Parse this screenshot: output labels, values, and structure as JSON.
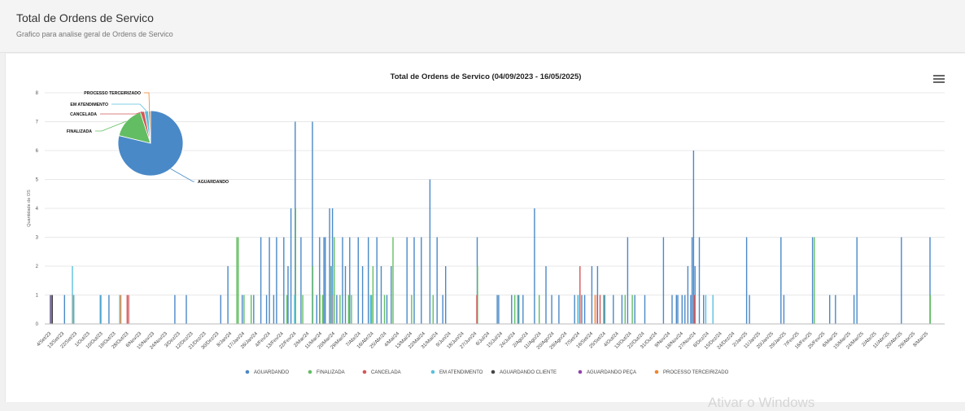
{
  "header": {
    "title": "Total de Ordens de Servico",
    "subtitle": "Grafico para analise geral de Ordens de Servico"
  },
  "watermark": "Ativar o Windows",
  "icons": {
    "menu": "hamburger-menu-icon"
  },
  "chart_data": {
    "type": "bar",
    "title": "Total de Ordens de Servico (04/09/2023 - 16/05/2025)",
    "ylabel": "Quantidade de OS",
    "xlabel": "",
    "ylim": [
      0,
      8
    ],
    "yticks": [
      0,
      1,
      2,
      3,
      4,
      5,
      6,
      7,
      8
    ],
    "grid": true,
    "legend_position": "bottom-center",
    "x_tick_labels": [
      "4/Set/23",
      "13/Set/23",
      "22/Set/23",
      "1/Out/23",
      "10/Out/23",
      "19/Out/23",
      "28/Out/23",
      "6/Nov/23",
      "15/Nov/23",
      "24/Nov/23",
      "3/Dez/23",
      "12/Dez/23",
      "21/Dez/23",
      "30/Dez/23",
      "8/Jan/24",
      "17/Jan/24",
      "26/Jan/24",
      "4/Fev/24",
      "13/Fev/24",
      "22/Fev/24",
      "2/Mar/24",
      "11/Mar/24",
      "20/Mar/24",
      "29/Mar/24",
      "7/Abr/24",
      "16/Abr/24",
      "25/Abr/24",
      "4/Mai/24",
      "13/Mai/24",
      "22/Mai/24",
      "31/Mai/24",
      "9/Jun/24",
      "18/Jun/24",
      "27/Jun/24",
      "6/Jul/24",
      "15/Jul/24",
      "24/Jul/24",
      "2/Ago/24",
      "11/Ago/24",
      "20/Ago/24",
      "29/Ago/24",
      "7/Set/24",
      "16/Set/24",
      "25/Set/24",
      "4/Out/24",
      "13/Out/24",
      "22/Out/24",
      "31/Out/24",
      "9/Nov/24",
      "18/Nov/24",
      "27/Nov/24",
      "6/Dez/24",
      "15/Dez/24",
      "24/Dez/24",
      "2/Jan/25",
      "11/Jan/25",
      "20/Jan/25",
      "29/Jan/25",
      "7/Fev/25",
      "16/Fev/25",
      "25/Fev/25",
      "6/Mar/25",
      "15/Mar/25",
      "24/Mar/25",
      "2/Abr/25",
      "11/Abr/25",
      "20/Abr/25",
      "29/Abr/25",
      "8/Mai/25"
    ],
    "series": [
      {
        "name": "AGUARDANDO",
        "color": "#4a89c8",
        "points": [
          [
            "2023-09-04",
            1
          ],
          [
            "2023-09-14",
            1
          ],
          [
            "2023-10-09",
            1
          ],
          [
            "2023-10-15",
            1
          ],
          [
            "2023-11-30",
            1
          ],
          [
            "2023-12-08",
            1
          ],
          [
            "2024-01-01",
            1
          ],
          [
            "2024-01-06",
            2
          ],
          [
            "2024-01-16",
            1
          ],
          [
            "2024-01-24",
            1
          ],
          [
            "2024-01-29",
            3
          ],
          [
            "2024-02-02",
            1
          ],
          [
            "2024-02-04",
            3
          ],
          [
            "2024-02-07",
            1
          ],
          [
            "2024-02-09",
            3
          ],
          [
            "2024-02-14",
            3
          ],
          [
            "2024-02-17",
            2
          ],
          [
            "2024-02-19",
            4
          ],
          [
            "2024-02-22",
            7
          ],
          [
            "2024-02-26",
            3
          ],
          [
            "2024-03-05",
            7
          ],
          [
            "2024-03-08",
            1
          ],
          [
            "2024-03-10",
            3
          ],
          [
            "2024-03-13",
            3
          ],
          [
            "2024-03-14",
            3
          ],
          [
            "2024-03-17",
            4
          ],
          [
            "2024-03-18",
            2
          ],
          [
            "2024-03-19",
            4
          ],
          [
            "2024-03-22",
            1
          ],
          [
            "2024-03-26",
            3
          ],
          [
            "2024-03-28",
            2
          ],
          [
            "2024-03-31",
            3
          ],
          [
            "2024-04-06",
            3
          ],
          [
            "2024-04-09",
            2
          ],
          [
            "2024-04-13",
            3
          ],
          [
            "2024-04-19",
            3
          ],
          [
            "2024-04-22",
            2
          ],
          [
            "2024-04-26",
            1
          ],
          [
            "2024-04-29",
            2
          ],
          [
            "2024-05-10",
            3
          ],
          [
            "2024-05-15",
            3
          ],
          [
            "2024-05-20",
            3
          ],
          [
            "2024-05-26",
            5
          ],
          [
            "2024-05-31",
            3
          ],
          [
            "2024-06-04",
            1
          ],
          [
            "2024-06-06",
            2
          ],
          [
            "2024-06-28",
            3
          ],
          [
            "2024-07-12",
            1
          ],
          [
            "2024-07-13",
            1
          ],
          [
            "2024-07-22",
            1
          ],
          [
            "2024-07-27",
            1
          ],
          [
            "2024-07-30",
            1
          ],
          [
            "2024-08-07",
            4
          ],
          [
            "2024-08-15",
            2
          ],
          [
            "2024-08-19",
            1
          ],
          [
            "2024-08-24",
            1
          ],
          [
            "2024-09-04",
            1
          ],
          [
            "2024-09-09",
            1
          ],
          [
            "2024-09-11",
            1
          ],
          [
            "2024-09-16",
            2
          ],
          [
            "2024-09-20",
            2
          ],
          [
            "2024-09-25",
            1
          ],
          [
            "2024-10-01",
            1
          ],
          [
            "2024-10-07",
            1
          ],
          [
            "2024-10-11",
            3
          ],
          [
            "2024-10-16",
            1
          ],
          [
            "2024-10-23",
            1
          ],
          [
            "2024-11-05",
            3
          ],
          [
            "2024-11-11",
            1
          ],
          [
            "2024-11-14",
            1
          ],
          [
            "2024-11-15",
            1
          ],
          [
            "2024-11-18",
            1
          ],
          [
            "2024-11-20",
            1
          ],
          [
            "2024-11-22",
            2
          ],
          [
            "2024-11-24",
            1
          ],
          [
            "2024-11-25",
            3
          ],
          [
            "2024-11-26",
            6
          ],
          [
            "2024-11-27",
            2
          ],
          [
            "2024-11-30",
            3
          ],
          [
            "2024-12-03",
            1
          ],
          [
            "2025-01-02",
            3
          ],
          [
            "2025-01-04",
            1
          ],
          [
            "2025-01-26",
            3
          ],
          [
            "2025-01-28",
            1
          ],
          [
            "2025-02-17",
            3
          ],
          [
            "2025-03-01",
            1
          ],
          [
            "2025-03-05",
            1
          ],
          [
            "2025-03-18",
            1
          ],
          [
            "2025-03-20",
            3
          ],
          [
            "2025-04-20",
            3
          ],
          [
            "2025-05-10",
            3
          ]
        ]
      },
      {
        "name": "FINALIZADA",
        "color": "#63bd63",
        "points": [
          [
            "2024-01-12",
            3
          ],
          [
            "2024-01-13",
            3
          ],
          [
            "2024-01-17",
            1
          ],
          [
            "2024-01-22",
            1
          ],
          [
            "2024-02-16",
            1
          ],
          [
            "2024-02-22",
            4
          ],
          [
            "2024-02-27",
            1
          ],
          [
            "2024-03-05",
            2
          ],
          [
            "2024-03-10",
            1
          ],
          [
            "2024-03-12",
            1
          ],
          [
            "2024-03-18",
            2
          ],
          [
            "2024-03-20",
            3
          ],
          [
            "2024-03-24",
            1
          ],
          [
            "2024-03-30",
            1
          ],
          [
            "2024-04-01",
            1
          ],
          [
            "2024-04-15",
            1
          ],
          [
            "2024-04-16",
            2
          ],
          [
            "2024-04-24",
            1
          ],
          [
            "2024-04-30",
            3
          ],
          [
            "2024-05-13",
            1
          ],
          [
            "2024-05-28",
            1
          ],
          [
            "2024-06-28",
            2
          ],
          [
            "2024-07-24",
            1
          ],
          [
            "2024-07-26",
            1
          ],
          [
            "2024-08-10",
            1
          ],
          [
            "2024-09-06",
            1
          ],
          [
            "2024-09-24",
            1
          ],
          [
            "2024-10-09",
            1
          ],
          [
            "2024-10-14",
            1
          ],
          [
            "2025-02-18",
            3
          ],
          [
            "2025-05-10",
            1
          ]
        ]
      },
      {
        "name": "CANCELADA",
        "color": "#d45757",
        "points": [
          [
            "2023-09-05",
            1
          ],
          [
            "2023-10-28",
            1
          ],
          [
            "2023-10-29",
            1
          ],
          [
            "2024-03-19",
            1
          ],
          [
            "2024-06-28",
            1
          ],
          [
            "2024-09-08",
            2
          ],
          [
            "2024-09-20",
            1
          ],
          [
            "2024-09-22",
            1
          ],
          [
            "2024-11-27",
            1
          ]
        ]
      },
      {
        "name": "EM ATENDIMENTO",
        "color": "#5bc0de",
        "points": [
          [
            "2023-09-19",
            2
          ],
          [
            "2023-09-20",
            1
          ],
          [
            "2023-10-09",
            1
          ],
          [
            "2023-10-22",
            1
          ],
          [
            "2024-02-21",
            1
          ],
          [
            "2024-03-18",
            2
          ],
          [
            "2024-04-14",
            1
          ],
          [
            "2024-09-06",
            1
          ],
          [
            "2024-12-04",
            1
          ],
          [
            "2024-12-09",
            1
          ]
        ]
      },
      {
        "name": "AGUARDANDO CLIENTE",
        "color": "#444444",
        "points": [
          [
            "2023-09-06",
            1
          ]
        ]
      },
      {
        "name": "AGUARDANDO PEÇA",
        "color": "#8e44ad",
        "points": []
      },
      {
        "name": "PROCESSO TERCEIRIZADO",
        "color": "#f0852d",
        "points": [
          [
            "2023-09-21",
            1
          ],
          [
            "2023-10-24",
            1
          ],
          [
            "2024-09-19",
            1
          ]
        ]
      }
    ],
    "pie": {
      "slices": [
        {
          "name": "AGUARDANDO",
          "value": 78,
          "color": "#4a89c8"
        },
        {
          "name": "FINALIZADA",
          "value": 16,
          "color": "#63bd63"
        },
        {
          "name": "CANCELADA",
          "value": 2,
          "color": "#d45757"
        },
        {
          "name": "EM ATENDIMENTO",
          "value": 2,
          "color": "#5bc0de"
        },
        {
          "name": "PROCESSO TERCEIRIZADO",
          "value": 1,
          "color": "#f0852d"
        }
      ]
    }
  }
}
